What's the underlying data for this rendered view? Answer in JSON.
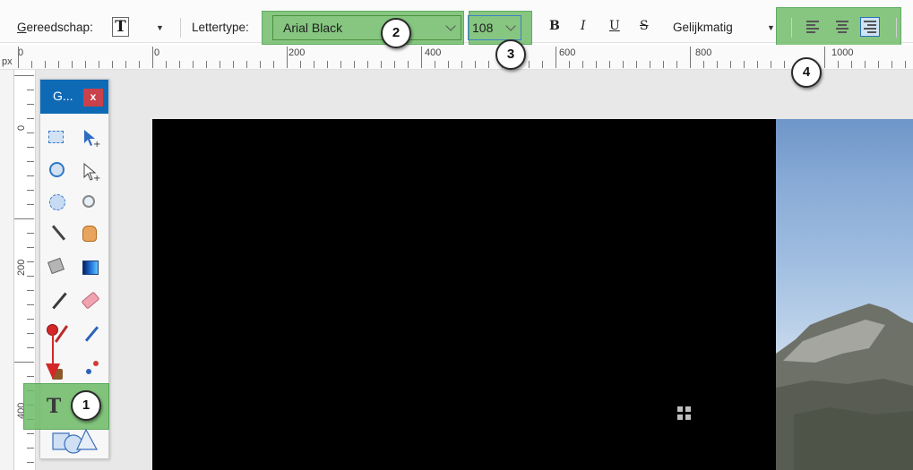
{
  "toolbar": {
    "tool_label": "Gereedschap:",
    "tool_label_access_key": "G",
    "tool_label_rest": "ereedschap:",
    "tool_glyph": "T",
    "font_label": "Lettertype:",
    "font_value": "Arial Black",
    "size_value": "108",
    "bold": "B",
    "italic": "I",
    "underline": "U",
    "strikethrough": "S",
    "antialias_label": "Gelijkmatig",
    "align_buttons": [
      "align-left-icon",
      "align-center-icon",
      "align-right-icon"
    ],
    "align_active": "align-right"
  },
  "ruler": {
    "unit": "px",
    "top_labels": [
      "0",
      "0",
      "200",
      "400",
      "600",
      "800",
      "1000"
    ],
    "left_labels": [
      "0",
      "200",
      "400"
    ]
  },
  "tools_panel": {
    "title": "G...",
    "close_label": "x",
    "text_tool_glyph": "T",
    "tools": [
      "rectangle-select-icon",
      "move-selection-icon",
      "lasso-select-icon",
      "move-selected-icon",
      "ellipse-select-icon",
      "zoom-icon",
      "magic-wand-icon",
      "pan-icon",
      "paint-bucket-icon",
      "gradient-icon",
      "paintbrush-icon",
      "eraser-icon",
      "pencil-icon",
      "color-picker-icon",
      "clone-stamp-icon",
      "recolor-icon",
      "text-icon",
      "shapes-icon"
    ]
  },
  "callouts": [
    "1",
    "2",
    "3",
    "4"
  ],
  "colors": {
    "highlight": "#6dbb66",
    "panel_header": "#0f6ab6",
    "close_button": "#c9414a",
    "annotation_arrow": "#d42828"
  }
}
